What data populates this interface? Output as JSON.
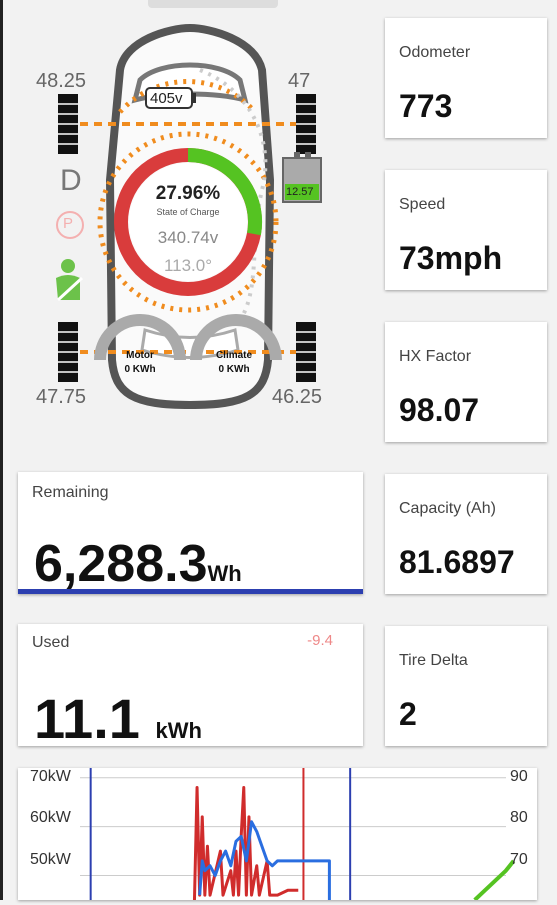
{
  "car": {
    "pack_voltage": "405v",
    "state_of_charge": "27.96%",
    "state_of_charge_label": "State of Charge",
    "battery_voltage": "340.74v",
    "battery_temp": "113.0°",
    "aux_battery": "12.57",
    "gear": "D",
    "park": "P",
    "motor_label": "Motor",
    "motor_value": "0 KWh",
    "climate_label": "Climate",
    "climate_value": "0 KWh",
    "tires": {
      "front_left": "48.25",
      "front_right": "47",
      "rear_left": "47.75",
      "rear_right": "46.25"
    },
    "colors": {
      "charge_red": "#d93c3c",
      "charge_green": "#55c322",
      "dotted_orange": "#f08c1e"
    }
  },
  "metrics": {
    "odometer": {
      "label": "Odometer",
      "value": "773"
    },
    "speed": {
      "label": "Speed",
      "value": "73mph"
    },
    "hx_factor": {
      "label": "HX Factor",
      "value": "98.07"
    },
    "capacity": {
      "label": "Capacity (Ah)",
      "value": "81.6897"
    },
    "tire_delta": {
      "label": "Tire Delta",
      "value": "2"
    }
  },
  "remaining": {
    "label": "Remaining",
    "value": "6,288.3",
    "unit": "Wh"
  },
  "used": {
    "label": "Used",
    "value": "11.1",
    "unit": "kWh",
    "delta": "-9.4"
  },
  "chart_data": {
    "type": "line",
    "left_axis": {
      "ticks": [
        "70kW",
        "60kW",
        "50kW"
      ],
      "tick_values": [
        70,
        60,
        50
      ],
      "range": [
        45,
        72
      ]
    },
    "right_axis": {
      "ticks": [
        "90",
        "80",
        "70"
      ],
      "tick_values": [
        90,
        80,
        70
      ],
      "range": [
        65,
        92
      ]
    },
    "grid": true,
    "series": [
      {
        "color": "#d02c2c",
        "axis": "left",
        "points": [
          [
            0.34,
            45
          ],
          [
            0.345,
            68
          ],
          [
            0.35,
            46
          ],
          [
            0.355,
            62
          ],
          [
            0.36,
            46
          ],
          [
            0.365,
            56
          ],
          [
            0.37,
            46
          ],
          [
            0.39,
            55
          ],
          [
            0.395,
            46
          ],
          [
            0.41,
            51
          ],
          [
            0.415,
            46
          ],
          [
            0.42,
            55
          ],
          [
            0.425,
            46
          ],
          [
            0.43,
            58
          ],
          [
            0.435,
            68
          ],
          [
            0.44,
            46
          ],
          [
            0.445,
            62
          ],
          [
            0.45,
            46
          ],
          [
            0.46,
            52
          ],
          [
            0.465,
            46
          ],
          [
            0.48,
            53
          ],
          [
            0.485,
            46
          ],
          [
            0.5,
            46
          ],
          [
            0.52,
            47
          ],
          [
            0.54,
            47
          ]
        ]
      },
      {
        "color": "#2a6ee0",
        "axis": "left",
        "points": [
          [
            0.35,
            46
          ],
          [
            0.355,
            53
          ],
          [
            0.36,
            51
          ],
          [
            0.37,
            52
          ],
          [
            0.38,
            50
          ],
          [
            0.39,
            53
          ],
          [
            0.4,
            55
          ],
          [
            0.41,
            52
          ],
          [
            0.42,
            57
          ],
          [
            0.43,
            58
          ],
          [
            0.44,
            53
          ],
          [
            0.45,
            61
          ],
          [
            0.46,
            59
          ],
          [
            0.47,
            56
          ],
          [
            0.48,
            53
          ],
          [
            0.49,
            52
          ],
          [
            0.5,
            53
          ],
          [
            0.52,
            53
          ],
          [
            0.54,
            53
          ],
          [
            0.56,
            53
          ],
          [
            0.58,
            53
          ],
          [
            0.6,
            53
          ],
          [
            0.6,
            45
          ]
        ]
      },
      {
        "color": "#55c322",
        "axis": "right",
        "points": [
          [
            0.88,
            65
          ],
          [
            0.9,
            67
          ],
          [
            0.92,
            69
          ],
          [
            0.94,
            71
          ],
          [
            0.955,
            73
          ]
        ]
      }
    ],
    "markers": [
      {
        "x": 0.55,
        "color": "#d02c2c"
      },
      {
        "x": 0.64,
        "color": "#2c3fb0"
      },
      {
        "x": 0.14,
        "color": "#2c3fb0"
      }
    ]
  }
}
